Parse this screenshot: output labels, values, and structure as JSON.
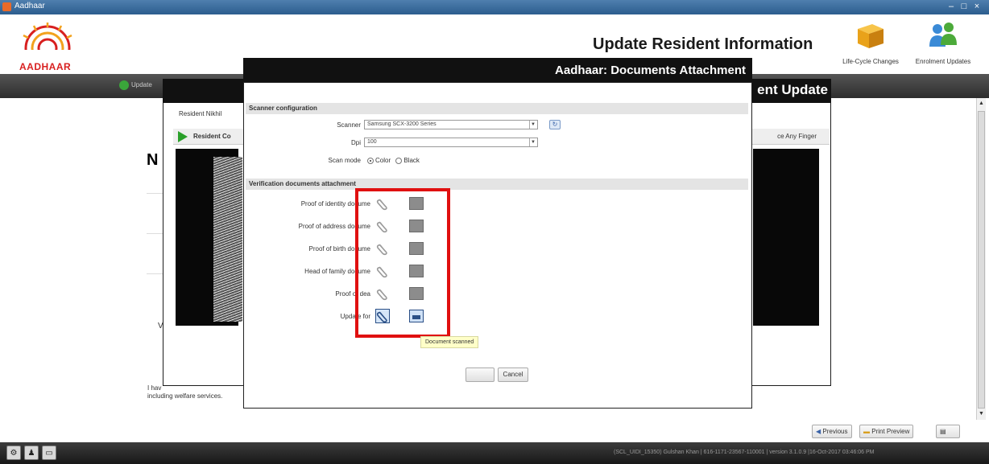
{
  "window": {
    "title": "Aadhaar",
    "controls": [
      "–",
      "□",
      "×"
    ]
  },
  "header": {
    "logo_text": "AADHAAR",
    "title": "Update Resident Information",
    "buttons": [
      {
        "label": "Life-Cycle Changes",
        "icon": "box-icon"
      },
      {
        "label": "Enrolment Updates",
        "icon": "users-icon"
      }
    ]
  },
  "navbar": {
    "update_label": "Update"
  },
  "background": {
    "panel_title": "ent Update",
    "tabs": "Resident   Nikhil",
    "resident_label": "Resident Co",
    "finger_label": "ce Any Finger",
    "big_letter": "N",
    "side_letter": "V",
    "bottom_text_1": "I hav",
    "bottom_text_2": "including welfare services."
  },
  "dialog": {
    "title": "Aadhaar: Documents Attachment",
    "scanner_section": "Scanner configuration",
    "scanner_label": "Scanner",
    "scanner_value": "Samsung SCX-3200 Series",
    "dpi_label": "Dpi",
    "dpi_value": "100",
    "scan_mode_label": "Scan mode",
    "scan_mode_options": [
      "Color",
      "Black"
    ],
    "scan_mode_selected": "Color",
    "verification_section": "Verification documents attachment",
    "documents": [
      {
        "label": "Proof of identity docume",
        "active": false
      },
      {
        "label": "Proof of address docume",
        "active": false
      },
      {
        "label": "Proof of birth docume",
        "active": false
      },
      {
        "label": "Head of family docume",
        "active": false
      },
      {
        "label": "Proof of dea",
        "active": false
      },
      {
        "label": "Update for",
        "active": true
      }
    ],
    "tooltip": "Document scanned",
    "ok_label": "",
    "cancel_label": "Cancel"
  },
  "footer": {
    "previous": "Previous",
    "print_preview": "Print Preview"
  },
  "statusbar": {
    "info": "(SCL_UIDI_15350) Gulshan Khan  |  616-1171-23567-110001  |  version 3.1.0.9  |16-Oct-2017 03:46:06 PM"
  },
  "colors": {
    "highlight": "#e01010",
    "accent": "#2a4f86"
  }
}
